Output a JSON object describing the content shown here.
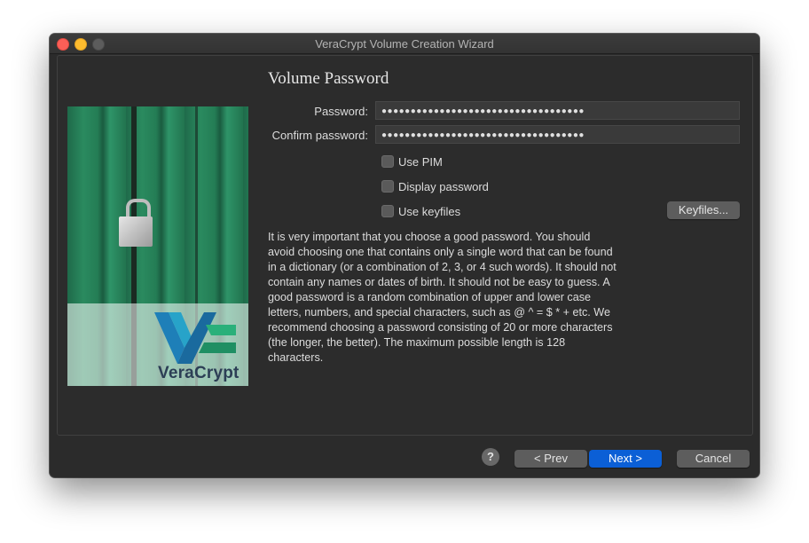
{
  "window": {
    "title": "VeraCrypt Volume Creation Wizard"
  },
  "page": {
    "heading": "Volume Password"
  },
  "form": {
    "password_label": "Password:",
    "password_value": "●●●●●●●●●●●●●●●●●●●●●●●●●●●●●●●●●●●",
    "confirm_label": "Confirm password:",
    "confirm_value": "●●●●●●●●●●●●●●●●●●●●●●●●●●●●●●●●●●●",
    "use_pim_label": "Use PIM",
    "display_password_label": "Display password",
    "use_keyfiles_label": "Use keyfiles",
    "keyfiles_button": "Keyfiles..."
  },
  "info_text": "It is very important that you choose a good password. You should avoid choosing one that contains only a single word that can be found in a dictionary (or a combination of 2, 3, or 4 such words). It should not contain any names or dates of birth. It should not be easy to guess. A good password is a random combination of upper and lower case letters, numbers, and special characters, such as @ ^ = $ * + etc. We recommend choosing a password consisting of 20 or more characters (the longer, the better). The maximum possible length is 128 characters.",
  "logo": {
    "text": "VeraCrypt"
  },
  "footer": {
    "help_icon": "?",
    "prev_button": "< Prev",
    "next_button": "Next >",
    "cancel_button": "Cancel"
  },
  "colors": {
    "accent": "#0b5fd6",
    "window_bg": "#2b2b2b"
  },
  "icons": [
    "close-icon",
    "minimize-icon",
    "maximize-icon",
    "help-icon"
  ]
}
